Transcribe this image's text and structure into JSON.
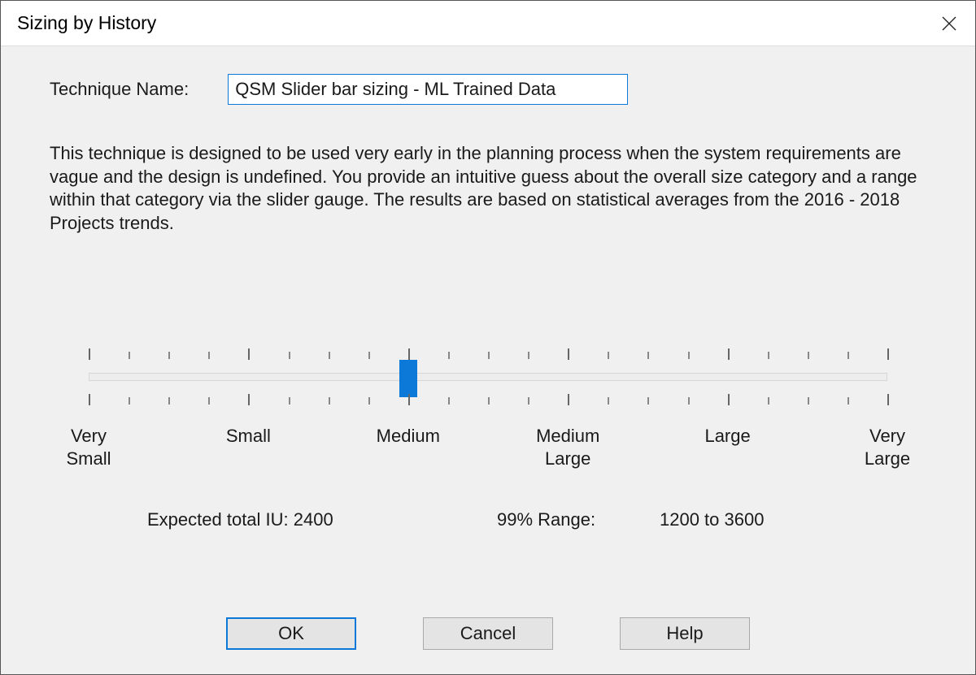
{
  "window": {
    "title": "Sizing by History"
  },
  "technique": {
    "label": "Technique Name:",
    "value": "QSM Slider bar sizing - ML Trained Data"
  },
  "description": "This technique is designed to be used very early in the planning process when the system requirements are vague and the design is undefined.  You provide an intuitive guess about the overall size category and a range within that category via the slider gauge.  The results are based on statistical averages from the 2016 - 2018 Projects trends.",
  "slider": {
    "categories": [
      "Very Small",
      "Small",
      "Medium",
      "Medium Large",
      "Large",
      "Very Large"
    ],
    "minor_ticks_per_segment": 3,
    "position_fraction": 0.4
  },
  "results": {
    "expected_label": "Expected total IU:",
    "expected_value": "2400",
    "range_label": "99% Range:",
    "range_value": "1200 to 3600"
  },
  "buttons": {
    "ok": "OK",
    "cancel": "Cancel",
    "help": "Help"
  },
  "colors": {
    "accent": "#0c79d8"
  }
}
